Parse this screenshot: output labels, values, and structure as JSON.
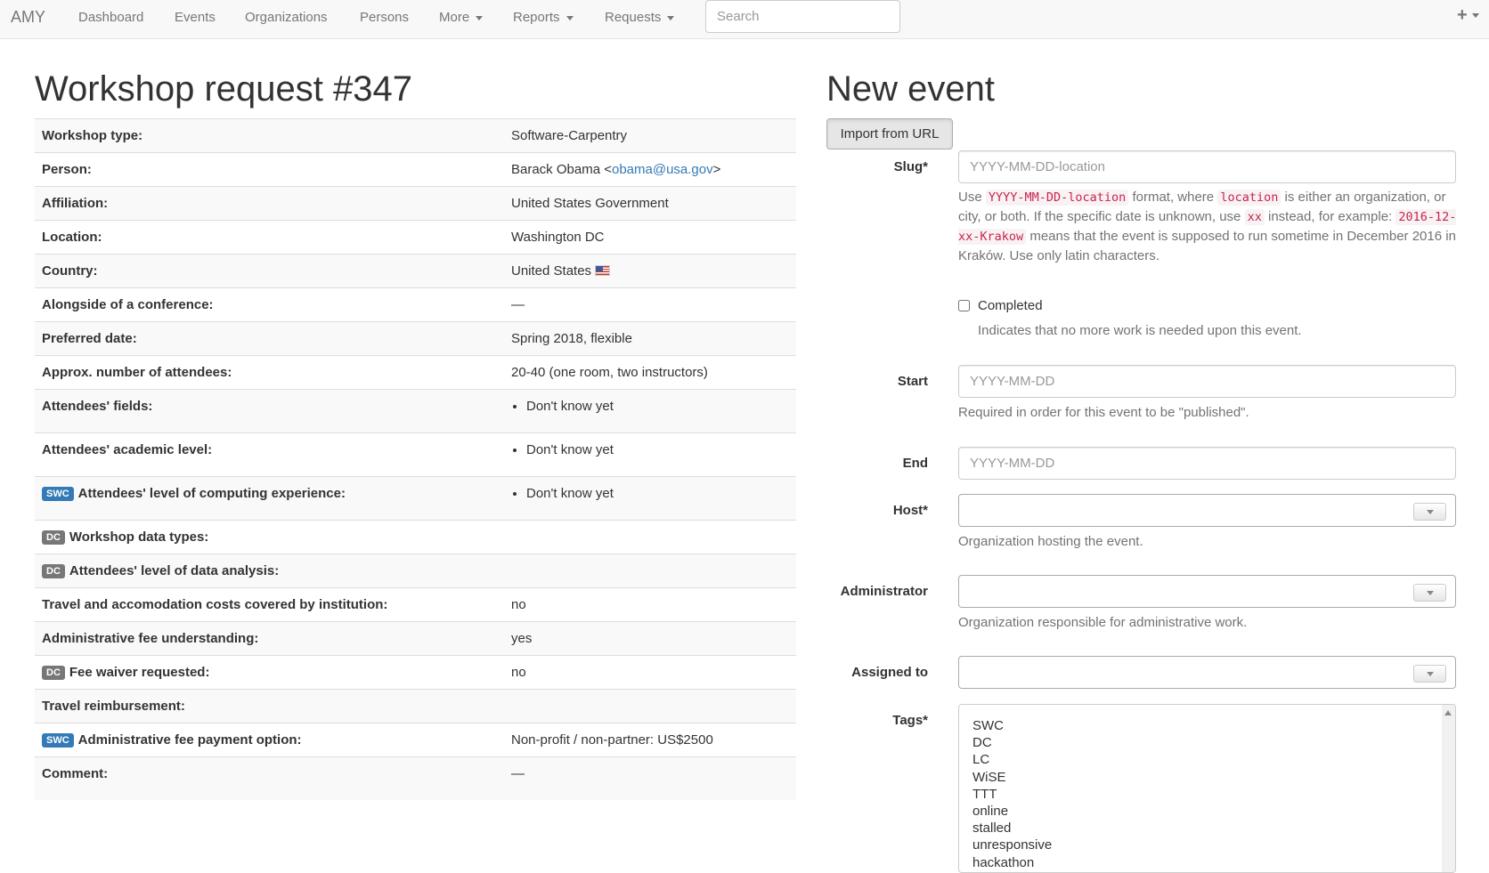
{
  "navbar": {
    "brand": "AMY",
    "items": [
      {
        "label": "Dashboard"
      },
      {
        "label": "Events"
      },
      {
        "label": "Organizations"
      },
      {
        "label": "Persons"
      },
      {
        "label": "More"
      },
      {
        "label": "Reports"
      },
      {
        "label": "Requests"
      }
    ],
    "search_placeholder": "Search",
    "plus_icon": "plus-icon"
  },
  "request": {
    "title": "Workshop request #347",
    "rows": [
      {
        "label": "Workshop type:",
        "value": "Software-Carpentry"
      },
      {
        "label": "Person:",
        "name": "Barack Obama",
        "email": "obama@usa.gov"
      },
      {
        "label": "Affiliation:",
        "value": "United States Government"
      },
      {
        "label": "Location:",
        "value": "Washington DC"
      },
      {
        "label": "Country:",
        "value": "United States",
        "flag_icon": "us-flag-icon"
      },
      {
        "label": "Alongside of a conference:",
        "value": "—"
      },
      {
        "label": "Preferred date:",
        "value": "Spring 2018, flexible"
      },
      {
        "label": "Approx. number of attendees:",
        "value": "20-40 (one room, two instructors)"
      },
      {
        "label": "Attendees' fields:",
        "list": [
          "Don't know yet"
        ]
      },
      {
        "label": "Attendees' academic level:",
        "list": [
          "Don't know yet"
        ]
      },
      {
        "badge": "SWC",
        "label": "Attendees' level of computing experience:",
        "list": [
          "Don't know yet"
        ]
      },
      {
        "badge": "DC",
        "label": "Workshop data types:",
        "value": ""
      },
      {
        "badge": "DC",
        "label": "Attendees' level of data analysis:",
        "value": ""
      },
      {
        "label": "Travel and accomodation costs covered by institution:",
        "value": "no"
      },
      {
        "label": "Administrative fee understanding:",
        "value": "yes"
      },
      {
        "badge": "DC",
        "label": "Fee waiver requested:",
        "value": "no"
      },
      {
        "label": "Travel reimbursement:",
        "value": ""
      },
      {
        "badge": "SWC",
        "label": "Administrative fee payment option:",
        "value": "Non-profit / non-partner: US$2500"
      },
      {
        "label": "Comment:",
        "value": "—"
      }
    ]
  },
  "new_event": {
    "title": "New event",
    "import_button": "Import from URL",
    "slug": {
      "label": "Slug*",
      "placeholder": "YYYY-MM-DD-location",
      "help": {
        "t1": "Use ",
        "c1": "YYYY-MM-DD-location",
        "t2": " format, where ",
        "c2": "location",
        "t3": " is either an organization, or city, or both. If the specific date is unknown, use ",
        "c3": "xx",
        "t4": " instead, for example: ",
        "c4": "2016-12-xx-Krakow",
        "t5": " means that the event is supposed to run sometime in December 2016 in Kraków. Use only latin characters."
      }
    },
    "completed": {
      "label": "Completed",
      "help": "Indicates that no more work is needed upon this event.",
      "checked": false
    },
    "start": {
      "label": "Start",
      "placeholder": "YYYY-MM-DD",
      "help": "Required in order for this event to be \"published\"."
    },
    "end": {
      "label": "End",
      "placeholder": "YYYY-MM-DD"
    },
    "host": {
      "label": "Host*",
      "value": "",
      "help": "Organization hosting the event."
    },
    "administrator": {
      "label": "Administrator",
      "value": "",
      "help": "Organization responsible for administrative work."
    },
    "assigned_to": {
      "label": "Assigned to",
      "value": ""
    },
    "tags": {
      "label": "Tags*",
      "options": [
        "SWC",
        "DC",
        "LC",
        "WiSE",
        "TTT",
        "online",
        "stalled",
        "unresponsive",
        "hackathon"
      ]
    }
  }
}
